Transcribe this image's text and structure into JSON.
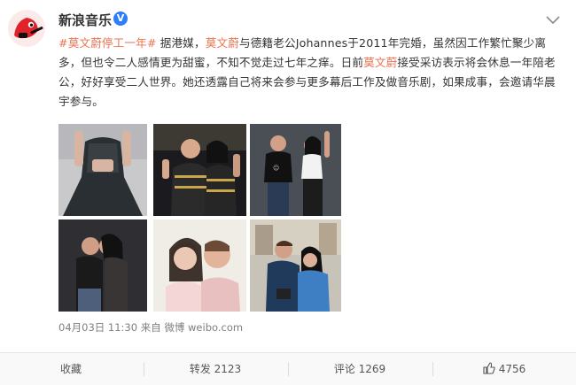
{
  "account": {
    "name": "新浪音乐",
    "verified_badge": "V"
  },
  "post": {
    "hashtag": "#莫文蔚停工一年#",
    "segments": [
      {
        "t": " 据港媒，",
        "h": false
      },
      {
        "t": "莫文蔚",
        "h": true
      },
      {
        "t": "与德籍老公Johannes于2011年完婚，虽然因工作繁忙聚少离多，但也令二人感情更为甜蜜，不知不觉走过七年之痒。日前",
        "h": false
      },
      {
        "t": "莫文蔚",
        "h": true
      },
      {
        "t": "接受采访表示将会休息一年陪老公，好好享受二人世界。她还透露自己将来会参与更多幕后工作及做音乐剧，如果成事，会邀请华晨宇参与。",
        "h": false
      }
    ],
    "meta": "04月03日 11:30 来自 微博 weibo.com"
  },
  "footer": {
    "favorite_label": "收藏",
    "repost_label": "转发 2123",
    "comment_label": "评论 1269",
    "like_count": "4756"
  },
  "colors": {
    "accent": "#eb7350",
    "verified": "#2c7ef8",
    "text": "#333333",
    "muted": "#808080"
  }
}
